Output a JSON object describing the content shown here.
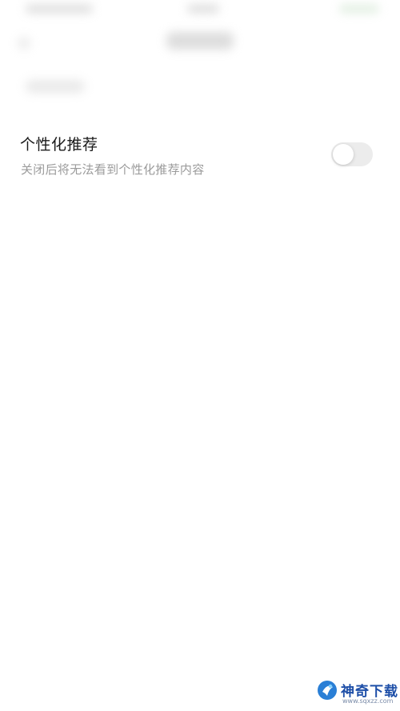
{
  "setting": {
    "title": "个性化推荐",
    "description": "关闭后将无法看到个性化推荐内容",
    "enabled": false
  },
  "watermark": {
    "brand": "神奇下载",
    "url": "www.sqxzz.com"
  },
  "colors": {
    "title_text": "#1a1a1a",
    "description_text": "#9b9b9b",
    "toggle_off_track": "#ececec",
    "watermark_blue": "#1e4fa8"
  }
}
